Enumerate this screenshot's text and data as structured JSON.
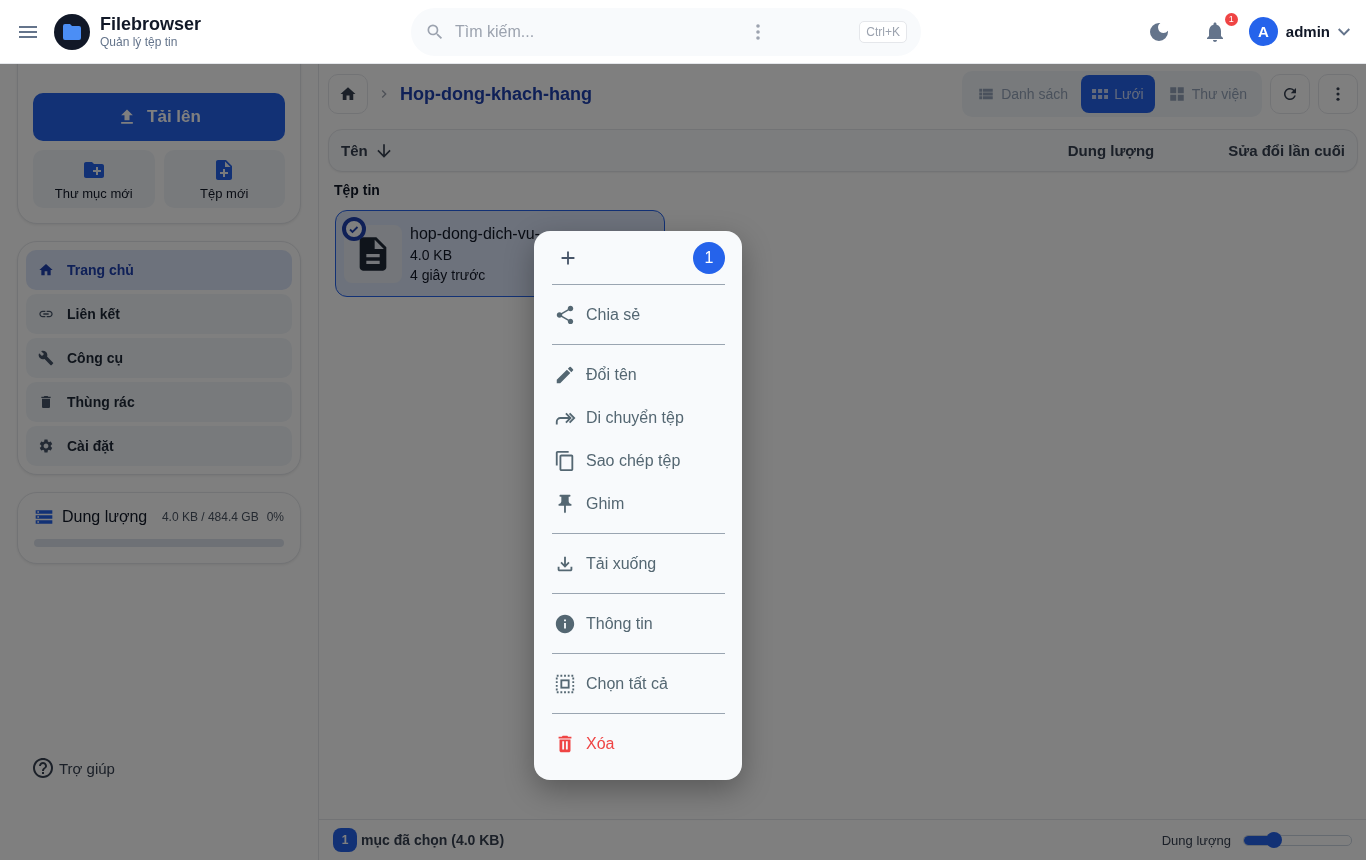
{
  "header": {
    "app_title": "Filebrowser",
    "app_subtitle": "Quản lý tệp tin",
    "search": {
      "placeholder": "Tìm kiếm..."
    },
    "shortcut": "Ctrl+K",
    "notification_count": "1",
    "avatar_letter": "A",
    "username": "admin"
  },
  "sidebar": {
    "upload_button": "Tải lên",
    "quick_actions": [
      {
        "label": "Thư mục mới",
        "kind": "folder"
      },
      {
        "label": "Tệp mới",
        "kind": "file"
      }
    ],
    "nav": [
      {
        "label": "Trang chủ",
        "kind": "home",
        "selected": true
      },
      {
        "label": "Liên kết",
        "kind": "link",
        "selected": false
      },
      {
        "label": "Công cụ",
        "kind": "tools",
        "selected": false
      },
      {
        "label": "Thùng rác",
        "kind": "trash",
        "selected": false
      },
      {
        "label": "Cài đặt",
        "kind": "settings",
        "selected": false
      }
    ],
    "storage": {
      "label": "Dung lượng",
      "usage": "4.0 KB / 484.4 GB",
      "percent": "0%",
      "level": 0
    },
    "help": "Trợ giúp"
  },
  "main": {
    "breadcrumb": "Hop-dong-khach-hang",
    "view_modes": [
      {
        "label": "Danh sách",
        "kind": "list",
        "selected": false
      },
      {
        "label": "Lưới",
        "kind": "grid",
        "selected": true
      },
      {
        "label": "Thư viện",
        "kind": "gallery",
        "selected": false
      }
    ],
    "columns": [
      "Tên",
      "Dung lượng",
      "Sửa đổi lần cuối"
    ],
    "section_title": "Tệp tin",
    "files": [
      {
        "name": "hop-dong-dich-vu-",
        "size": "4.0 KB",
        "modified": "4 giây trước",
        "selected": true
      }
    ]
  },
  "context_menu": {
    "count": "1",
    "groups": [
      [
        {
          "label": "Chia sẻ",
          "kind": "share"
        }
      ],
      [
        {
          "label": "Đổi tên",
          "kind": "rename"
        },
        {
          "label": "Di chuyển tệp",
          "kind": "move"
        },
        {
          "label": "Sao chép tệp",
          "kind": "copy"
        },
        {
          "label": "Ghim",
          "kind": "pin"
        }
      ],
      [
        {
          "label": "Tải xuống",
          "kind": "download"
        }
      ],
      [
        {
          "label": "Thông tin",
          "kind": "info"
        }
      ],
      [
        {
          "label": "Chọn tất cả",
          "kind": "select_all"
        }
      ],
      [
        {
          "label": "Xóa",
          "kind": "delete"
        }
      ]
    ]
  },
  "status_bar": {
    "count": "1",
    "text": "mục đã chọn (4.0 KB)",
    "size_label": "Dung lượng",
    "level": 0.28
  }
}
